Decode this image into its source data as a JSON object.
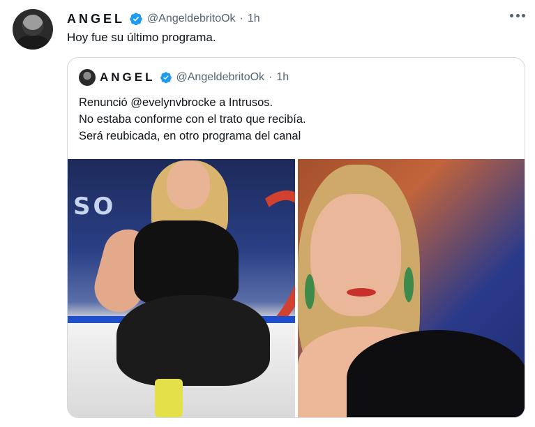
{
  "tweet": {
    "author_name": "ANGEL",
    "handle": "@AngeldebritoOk",
    "separator": "·",
    "time": "1h",
    "text": "Hoy fue su último programa."
  },
  "quoted_tweet": {
    "author_name": "ANGEL",
    "handle": "@AngeldebritoOk",
    "separator": "·",
    "time": "1h",
    "lines": [
      "Renunció @evelynvbrocke a Intrusos.",
      "No estaba conforme con el trato que recibía.",
      "Será reubicada, en otro programa del canal"
    ],
    "studio_sign_text": "SO"
  },
  "icons": {
    "verified": "verified-badge-icon",
    "more": "more-options-icon"
  },
  "colors": {
    "verified_blue": "#1d9bf0",
    "secondary_text": "#536471",
    "border": "#cfd9de"
  }
}
